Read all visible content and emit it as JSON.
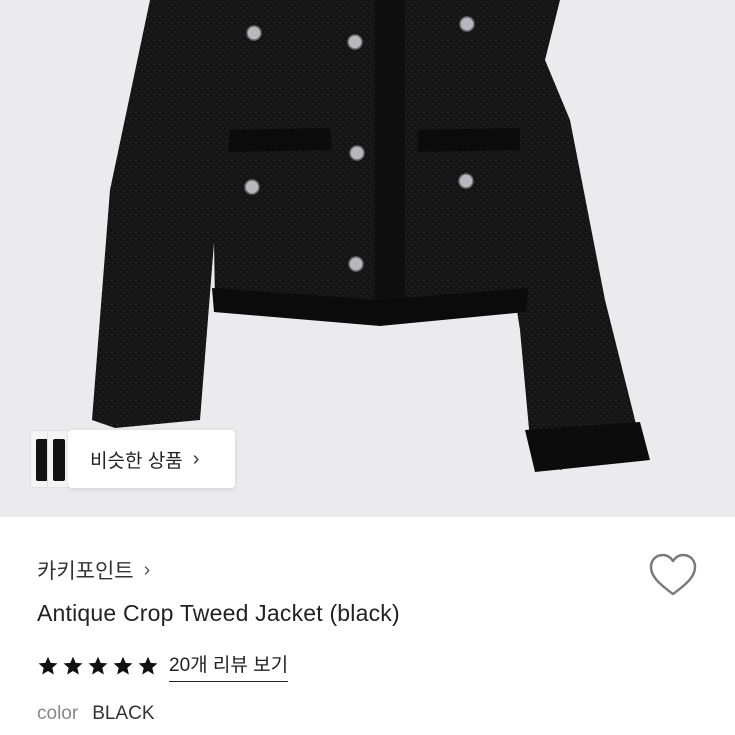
{
  "similar_products": {
    "label": "비슷한 상품",
    "chevron_icon": "chevron-right-icon",
    "thumbnail_icon": "jacket-thumbnail"
  },
  "product": {
    "brand": "카키포인트",
    "brand_chevron_icon": "chevron-right-icon",
    "name": "Antique Crop Tweed Jacket (black)",
    "wishlist_icon": "heart-outline-icon",
    "rating_stars": 5,
    "rating_max": 5,
    "review_link": "20개 리뷰 보기",
    "option_label": "color",
    "option_value": "BLACK"
  },
  "colors": {
    "hero_background": "#ebebed",
    "jacket": "#141414",
    "star": "#111111"
  }
}
